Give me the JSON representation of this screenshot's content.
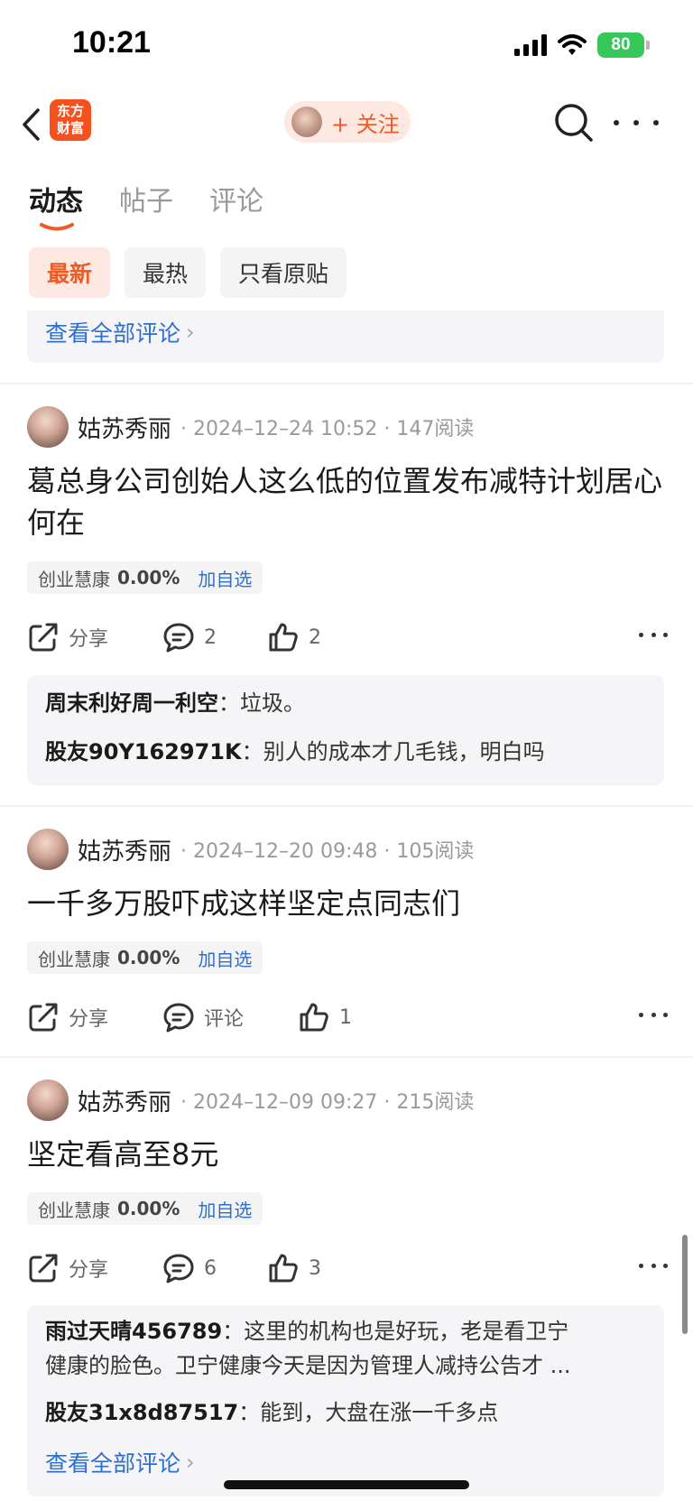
{
  "status_bar": {
    "time": "10:21",
    "battery": "80"
  },
  "nav": {
    "logo_line1": "东方",
    "logo_line2": "财富",
    "follow_label": "+ 关注"
  },
  "tabs": [
    {
      "label": "动态"
    },
    {
      "label": "帖子"
    },
    {
      "label": "评论"
    }
  ],
  "filters": [
    {
      "label": "最新"
    },
    {
      "label": "最热"
    },
    {
      "label": "只看原贴"
    }
  ],
  "top_comments": {
    "view_all": "查看全部评论"
  },
  "posts": [
    {
      "author": "姑苏秀丽",
      "meta": "· 2024–12–24 10:52 · 147阅读",
      "title": "葛总身公司创始人这么低的位置发布减特计划居心何在",
      "stock": {
        "name": "创业慧康",
        "change": "0.00%",
        "add": "加自选"
      },
      "actions": {
        "share": "分享",
        "comments": "2",
        "likes": "2"
      },
      "replies": [
        {
          "user": "周末利好周一利空",
          "sep": "：",
          "text": "垃圾。"
        },
        {
          "user": "股友90Y162971K",
          "sep": "：",
          "text": "别人的成本才几毛钱，明白吗"
        }
      ]
    },
    {
      "author": "姑苏秀丽",
      "meta": "· 2024–12–20 09:48 · 105阅读",
      "title": "一千多万股吓成这样坚定点同志们",
      "stock": {
        "name": "创业慧康",
        "change": "0.00%",
        "add": "加自选"
      },
      "actions": {
        "share": "分享",
        "comments": "评论",
        "likes": "1"
      }
    },
    {
      "author": "姑苏秀丽",
      "meta": "· 2024–12–09 09:27 · 215阅读",
      "title": "坚定看高至8元",
      "stock": {
        "name": "创业慧康",
        "change": "0.00%",
        "add": "加自选"
      },
      "actions": {
        "share": "分享",
        "comments": "6",
        "likes": "3"
      },
      "replies": [
        {
          "user": "雨过天晴456789",
          "sep": "：",
          "text": "这里的机构也是好玩，老是看卫宁",
          "text2": "健康的脸色。卫宁健康今天是因为管理人减持公告才 ..."
        },
        {
          "user": "股友31x8d87517",
          "sep": "：",
          "text": "能到，大盘在涨一千多点"
        }
      ],
      "view_all": "查看全部评论"
    }
  ],
  "colors": {
    "accent": "#f05a23",
    "link": "#2d6fcf",
    "muted": "#9a9a9a"
  },
  "icons": [
    "back-chevron-icon",
    "logo-icon",
    "search-icon",
    "more-icon",
    "share-icon",
    "comment-icon",
    "like-icon",
    "chevron-right-icon"
  ]
}
